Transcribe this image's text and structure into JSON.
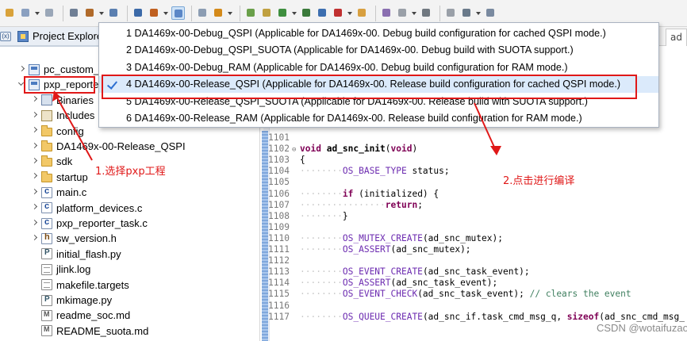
{
  "toolbar": {
    "icons": [
      "new-icon",
      "save-icon",
      "save-all-icon",
      "project-settings-icon",
      "build-hammer-icon",
      "binary-icon",
      "terminal-icon",
      "debug-config-icon",
      "search-icon",
      "refresh-icon",
      "open-file-icon",
      "external-tools-icon",
      "new-class-icon",
      "run-icon",
      "bug-icon",
      "at-icon",
      "stop-icon",
      "folder-open-icon",
      "pencil-icon",
      "toggle-icon",
      "paragraph-icon",
      "edit-icon",
      "dropdown-icon",
      "navigate-icon"
    ]
  },
  "left_panel": {
    "tab_title": "Project Explore",
    "side_marker": "(x)",
    "tree": [
      {
        "label": "pc_custom_",
        "type": "project",
        "twisty": "closed"
      },
      {
        "label": "pxp_reporte",
        "type": "project",
        "twisty": "open"
      },
      {
        "label": "Binaries",
        "type": "binaries",
        "twisty": "closed"
      },
      {
        "label": "Includes",
        "type": "includes",
        "twisty": "closed"
      },
      {
        "label": "config",
        "type": "folder",
        "twisty": "closed"
      },
      {
        "label": "DA1469x-00-Release_QSPI",
        "type": "folder",
        "twisty": "closed"
      },
      {
        "label": "sdk",
        "type": "folder",
        "twisty": "closed"
      },
      {
        "label": "startup",
        "type": "folder",
        "twisty": "closed"
      },
      {
        "label": "main.c",
        "type": "cfile",
        "twisty": "closed"
      },
      {
        "label": "platform_devices.c",
        "type": "cfile",
        "twisty": "closed"
      },
      {
        "label": "pxp_reporter_task.c",
        "type": "cfile",
        "twisty": "closed"
      },
      {
        "label": "sw_version.h",
        "type": "hfile",
        "twisty": "closed"
      },
      {
        "label": "initial_flash.py",
        "type": "pyfile",
        "twisty": "none"
      },
      {
        "label": "jlink.log",
        "type": "txtfile",
        "twisty": "none"
      },
      {
        "label": "makefile.targets",
        "type": "txtfile",
        "twisty": "none"
      },
      {
        "label": "mkimage.py",
        "type": "pyfile",
        "twisty": "none"
      },
      {
        "label": "readme_soc.md",
        "type": "mdfile",
        "twisty": "none"
      },
      {
        "label": "README_suota.md",
        "type": "mdfile",
        "twisty": "none"
      }
    ]
  },
  "editor": {
    "tab_right": "ad",
    "lines": [
      {
        "num": "1101",
        "html": ""
      },
      {
        "num": "1102",
        "fold": "⊖",
        "html": "<span class=\"kw\">void</span> <span class=\"fn\">ad_snc_init</span>(<span class=\"kw\">void</span>)"
      },
      {
        "num": "1103",
        "html": "{"
      },
      {
        "num": "1104",
        "html": "<span class=\"dot\">········</span><span class=\"mac\">OS_BASE_TYPE</span> status;"
      },
      {
        "num": "1105",
        "html": ""
      },
      {
        "num": "1106",
        "html": "<span class=\"dot\">········</span><span class=\"kw\">if</span> (initialized) {"
      },
      {
        "num": "1107",
        "html": "<span class=\"dot\">················</span><span class=\"kw\">return</span>;"
      },
      {
        "num": "1108",
        "html": "<span class=\"dot\">········</span>}"
      },
      {
        "num": "1109",
        "html": ""
      },
      {
        "num": "1110",
        "html": "<span class=\"dot\">········</span><span class=\"mac\">OS_MUTEX_CREATE</span>(ad_snc_mutex);"
      },
      {
        "num": "1111",
        "html": "<span class=\"dot\">········</span><span class=\"mac\">OS_ASSERT</span>(ad_snc_mutex);"
      },
      {
        "num": "1112",
        "html": ""
      },
      {
        "num": "1113",
        "html": "<span class=\"dot\">········</span><span class=\"mac\">OS_EVENT_CREATE</span>(ad_snc_task_event);"
      },
      {
        "num": "1114",
        "html": "<span class=\"dot\">········</span><span class=\"mac\">OS_ASSERT</span>(ad_snc_task_event);"
      },
      {
        "num": "1115",
        "html": "<span class=\"dot\">········</span><span class=\"mac\">OS_EVENT_CHECK</span>(ad_snc_task_event); <span class=\"cm\">// clears the event</span>"
      },
      {
        "num": "1116",
        "html": ""
      },
      {
        "num": "1117",
        "html": "<span class=\"dot\">········</span><span class=\"mac\">OS_QUEUE_CREATE</span>(ad_snc_if.task_cmd_msg_q, <span class=\"kw\">sizeof</span>(ad_snc_cmd_msg_"
      }
    ]
  },
  "build_menu": {
    "items": [
      {
        "label": "1 DA1469x-00-Debug_QSPI (Applicable for DA1469x-00. Debug build configuration for cached QSPI mode.)",
        "checked": false
      },
      {
        "label": "2 DA1469x-00-Debug_QSPI_SUOTA (Applicable for DA1469x-00. Debug build with SUOTA support.)",
        "checked": false
      },
      {
        "label": "3 DA1469x-00-Debug_RAM (Applicable for DA1469x-00. Debug build configuration for RAM mode.)",
        "checked": false
      },
      {
        "label": "4 DA1469x-00-Release_QSPI (Applicable for DA1469x-00. Release build configuration for cached QSPI mode.)",
        "checked": true
      },
      {
        "label": "5 DA1469x-00-Release_QSPI_SUOTA (Applicable for DA1469x-00. Release build with SUOTA support.)",
        "checked": false
      },
      {
        "label": "6 DA1469x-00-Release_RAM (Applicable for DA1469x-00. Release build configuration for RAM mode.)",
        "checked": false
      }
    ]
  },
  "annotations": {
    "step1": "1.选择pxp工程",
    "step2": "2.点击进行编译",
    "color": "#e01818"
  },
  "watermark": "CSDN @wotaifuzao"
}
